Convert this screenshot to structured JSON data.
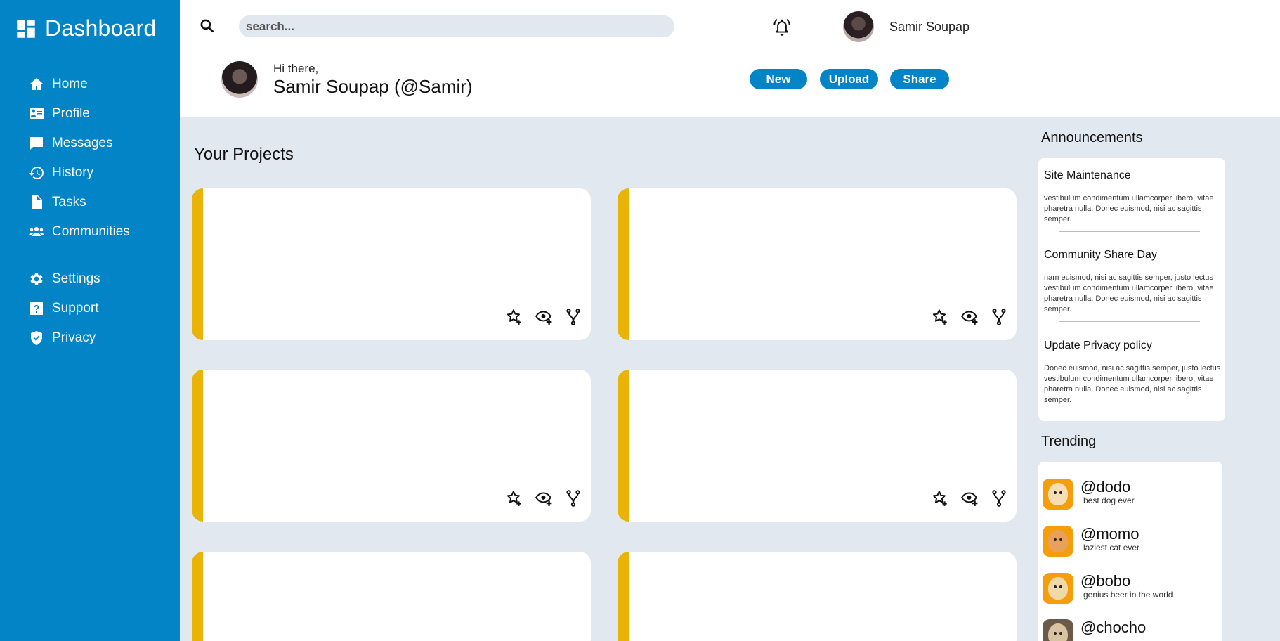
{
  "app": {
    "title": "Dashboard"
  },
  "sidebar": {
    "items": [
      {
        "label": "Home",
        "icon": "home-icon"
      },
      {
        "label": "Profile",
        "icon": "id-card-icon"
      },
      {
        "label": "Messages",
        "icon": "chat-icon"
      },
      {
        "label": "History",
        "icon": "history-icon"
      },
      {
        "label": "Tasks",
        "icon": "document-icon"
      },
      {
        "label": "Communities",
        "icon": "users-icon"
      }
    ],
    "secondary_items": [
      {
        "label": "Settings",
        "icon": "gear-icon"
      },
      {
        "label": "Support",
        "icon": "question-icon"
      },
      {
        "label": "Privacy",
        "icon": "shield-icon"
      }
    ]
  },
  "header": {
    "search_placeholder": "search...",
    "user_name": "Samir Soupap",
    "greeting": "Hi there,",
    "full_name": "Samir Soupap (@Samir)",
    "buttons": {
      "new": "New",
      "upload": "Upload",
      "share": "Share"
    }
  },
  "projects": {
    "title": "Your Projects"
  },
  "announcements": {
    "title": "Announcements",
    "items": [
      {
        "title": "Site Maintenance",
        "body": "vestibulum condimentum ullamcorper libero, vitae pharetra nulla. Donec euismod, nisi ac sagittis semper."
      },
      {
        "title": "Community Share Day",
        "body": "nam euismod, nisi ac sagittis semper, justo lectus vestibulum condimentum ullamcorper libero, vitae pharetra nulla. Donec euismod, nisi ac sagittis semper."
      },
      {
        "title": "Update Privacy policy",
        "body": "Donec euismod, nisi ac sagittis semper, justo lectus vestibulum condimentum ullamcorper libero, vitae pharetra nulla. Donec euismod, nisi ac sagittis semper."
      }
    ]
  },
  "trending": {
    "title": "Trending",
    "items": [
      {
        "handle": "@dodo",
        "desc": "best dog ever"
      },
      {
        "handle": "@momo",
        "desc": "laziest cat ever"
      },
      {
        "handle": "@bobo",
        "desc": "genius beer in the world"
      },
      {
        "handle": "@chocho",
        "desc": ""
      }
    ]
  },
  "colors": {
    "primary": "#0284c7",
    "accent": "#eab308",
    "background": "#e2e8f0"
  }
}
